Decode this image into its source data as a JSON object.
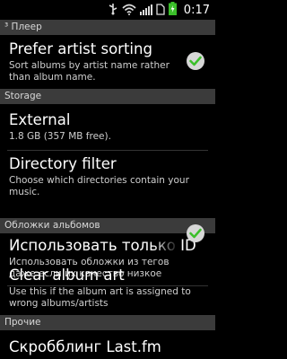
{
  "status_bar": {
    "time": "0:17",
    "icons": [
      "usb-icon",
      "wifi-icon",
      "signal-icon",
      "sim-icon",
      "battery-charging-icon"
    ]
  },
  "sections": {
    "player": {
      "header": "³ Плеер"
    },
    "storage": {
      "header": "Storage"
    },
    "covers": {
      "header": "Обложки альбомов"
    },
    "other": {
      "header": "Прочие"
    }
  },
  "items": {
    "prefer_artist_sorting": {
      "title": "Prefer artist sorting",
      "summary": "Sort albums by artist name rather than album name.",
      "checked": true
    },
    "external": {
      "title": "External",
      "summary": "1.8 GB (357 MB free)."
    },
    "directory_filter": {
      "title": "Directory filter",
      "summary": "Choose which directories contain your music."
    },
    "use_id3_only": {
      "title": "Использовать только ID",
      "summary": "Использовать обложки из тегов даже если их качество низкое",
      "checked": true
    },
    "clear_album_art": {
      "title": "Clear album art",
      "summary": "Use this if the album art is assigned to wrong albums/artists"
    },
    "scrobbling": {
      "title": "Скробблинг Last.fm"
    }
  }
}
